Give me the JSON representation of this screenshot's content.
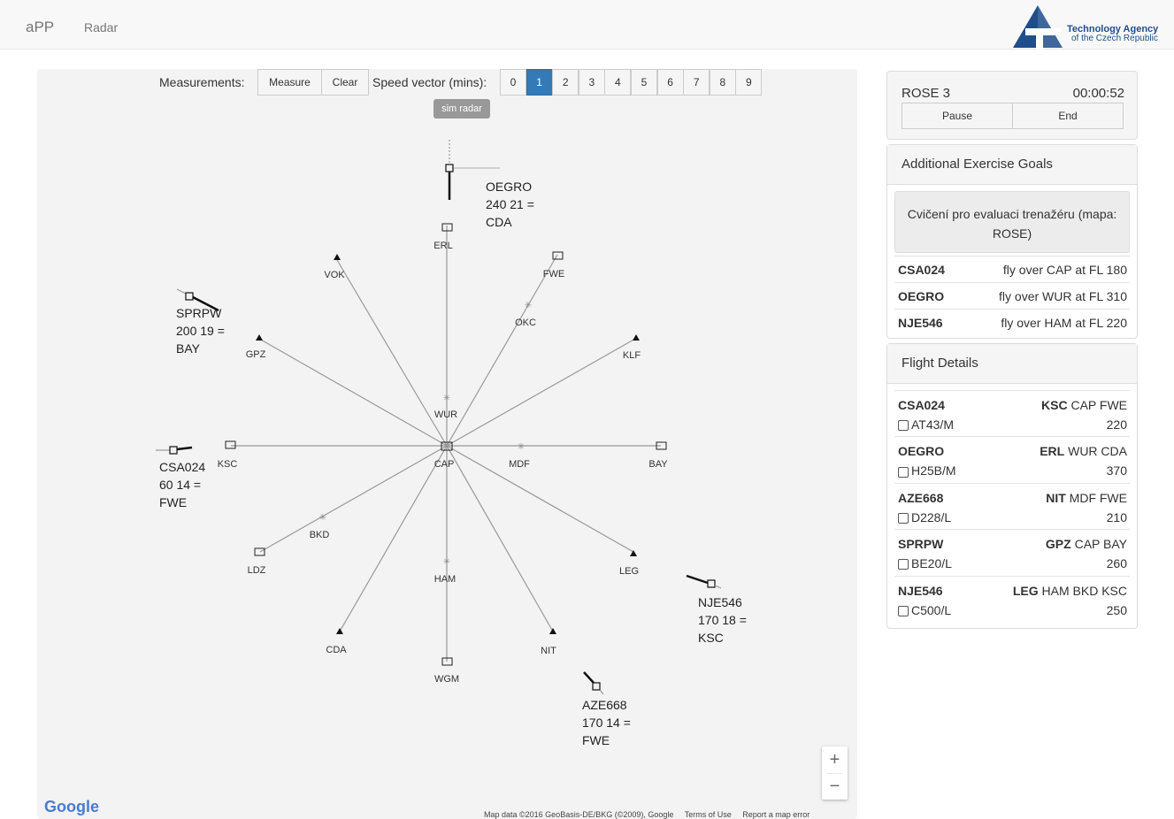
{
  "nav": {
    "brand": "aPP",
    "link": "Radar",
    "logo_line1": "Technology Agency",
    "logo_line2": "of the Czech Republic"
  },
  "toolbar": {
    "measurements_label": "Measurements:",
    "measure_label": "Measure",
    "clear_label": "Clear",
    "speed_label": "Speed vector (mins):",
    "speed_options": [
      "0",
      "1",
      "2",
      "3",
      "4",
      "5",
      "6",
      "7",
      "8",
      "9"
    ],
    "speed_selected": "1",
    "sim_badge": "sim radar"
  },
  "fixes": [
    {
      "name": "ERL",
      "type": "vor"
    },
    {
      "name": "FWE",
      "type": "vor"
    },
    {
      "name": "OKC",
      "type": "wpt"
    },
    {
      "name": "VOK",
      "type": "tri"
    },
    {
      "name": "GPZ",
      "type": "tri"
    },
    {
      "name": "KLF",
      "type": "tri"
    },
    {
      "name": "WUR",
      "type": "wpt"
    },
    {
      "name": "KSC",
      "type": "vor"
    },
    {
      "name": "CAP",
      "type": "vor"
    },
    {
      "name": "MDF",
      "type": "wpt"
    },
    {
      "name": "BAY",
      "type": "vor"
    },
    {
      "name": "BKD",
      "type": "wpt"
    },
    {
      "name": "LDZ",
      "type": "vor"
    },
    {
      "name": "HAM",
      "type": "wpt"
    },
    {
      "name": "LEG",
      "type": "tri"
    },
    {
      "name": "CDA",
      "type": "tri"
    },
    {
      "name": "NIT",
      "type": "tri"
    },
    {
      "name": "WGM",
      "type": "vor"
    }
  ],
  "aircraft": [
    {
      "callsign": "OEGRO",
      "line2": "240 21 =",
      "line3": "CDA"
    },
    {
      "callsign": "SPRPW",
      "line2": "200 19 =",
      "line3": "BAY"
    },
    {
      "callsign": "CSA024",
      "line2": "60 14 =",
      "line3": "FWE"
    },
    {
      "callsign": "NJE546",
      "line2": "170 18 =",
      "line3": "KSC"
    },
    {
      "callsign": "AZE668",
      "line2": "170 14 =",
      "line3": "FWE"
    }
  ],
  "map_controls": {
    "zoom_in": "+",
    "zoom_out": "−",
    "google": "Google",
    "attribution": "Map data ©2016 GeoBasis-DE/BKG (©2009), Google",
    "terms": "Terms of Use",
    "report": "Report a map error"
  },
  "session": {
    "name": "ROSE 3",
    "timer": "00:00:52",
    "pause_label": "Pause",
    "end_label": "End"
  },
  "goals": {
    "title": "Additional Exercise Goals",
    "description": "Cvičení pro evaluaci trenažéru (mapa: ROSE)",
    "items": [
      {
        "callsign": "CSA024",
        "goal": "fly over CAP at FL 180"
      },
      {
        "callsign": "OEGRO",
        "goal": "fly over WUR at FL 310"
      },
      {
        "callsign": "NJE546",
        "goal": "fly over HAM at FL 220"
      }
    ]
  },
  "flights": {
    "title": "Flight Details",
    "items": [
      {
        "callsign": "CSA024",
        "route_first": "KSC",
        "route_rest": " CAP FWE",
        "type": "AT43/M",
        "level": "220"
      },
      {
        "callsign": "OEGRO",
        "route_first": "ERL",
        "route_rest": " WUR CDA",
        "type": "H25B/M",
        "level": "370"
      },
      {
        "callsign": "AZE668",
        "route_first": "NIT",
        "route_rest": " MDF FWE",
        "type": "D228/L",
        "level": "210"
      },
      {
        "callsign": "SPRPW",
        "route_first": "GPZ",
        "route_rest": " CAP BAY",
        "type": "BE20/L",
        "level": "260"
      },
      {
        "callsign": "NJE546",
        "route_first": "LEG",
        "route_rest": " HAM BKD KSC",
        "type": "C500/L",
        "level": "250"
      }
    ]
  }
}
